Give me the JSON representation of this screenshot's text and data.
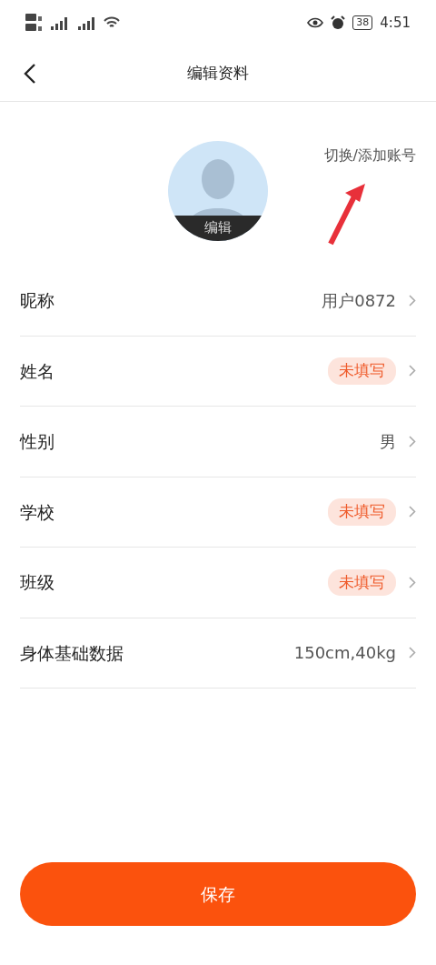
{
  "status_bar": {
    "battery": "38",
    "time": "4:51"
  },
  "header": {
    "title": "编辑资料"
  },
  "avatar": {
    "edit_label": "编辑"
  },
  "switch_account": "切换/添加账号",
  "fields": [
    {
      "label": "昵称",
      "kind": "value",
      "value": "用户0872"
    },
    {
      "label": "姓名",
      "kind": "tag",
      "value": "未填写"
    },
    {
      "label": "性别",
      "kind": "value",
      "value": "男"
    },
    {
      "label": "学校",
      "kind": "tag",
      "value": "未填写"
    },
    {
      "label": "班级",
      "kind": "tag",
      "value": "未填写"
    },
    {
      "label": "身体基础数据",
      "kind": "value",
      "value": "150cm,40kg"
    }
  ],
  "save_button": "保存"
}
